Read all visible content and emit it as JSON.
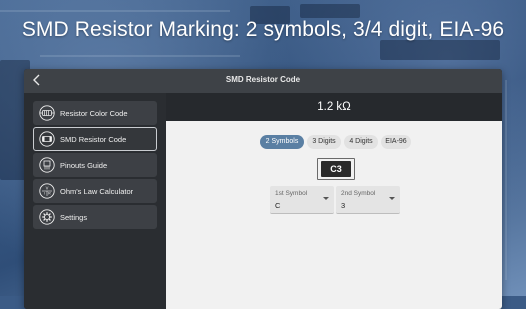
{
  "headline": "SMD Resistor Marking: 2 symbols, 3/4 digit, EIA-96",
  "app": {
    "title": "SMD Resistor Code",
    "back_icon": "back-arrow-icon"
  },
  "sidebar": {
    "items": [
      {
        "label": "Resistor Color Code",
        "icon": "resistor-icon",
        "active": false
      },
      {
        "label": "SMD Resistor Code",
        "icon": "smd-chip-icon",
        "active": true
      },
      {
        "label": "Pinouts Guide",
        "icon": "pinout-icon",
        "active": false
      },
      {
        "label": "Ohm's Law Calculator",
        "icon": "ohms-law-icon",
        "active": false
      },
      {
        "label": "Settings",
        "icon": "settings-gear-icon",
        "active": false
      }
    ]
  },
  "main": {
    "result": "1.2 kΩ",
    "tabs": [
      {
        "label": "2 Symbols",
        "active": true
      },
      {
        "label": "3 Digits",
        "active": false
      },
      {
        "label": "4 Digits",
        "active": false
      },
      {
        "label": "EIA-96",
        "active": false
      }
    ],
    "code": "C3",
    "selects": [
      {
        "caption": "1st Symbol",
        "value": "C"
      },
      {
        "caption": "2nd Symbol",
        "value": "3"
      }
    ]
  },
  "colors": {
    "accent": "#5a7fa3",
    "panel_dark": "#26292d",
    "sidebar": "#2a2d31",
    "content_bg": "#f1f1f1"
  }
}
